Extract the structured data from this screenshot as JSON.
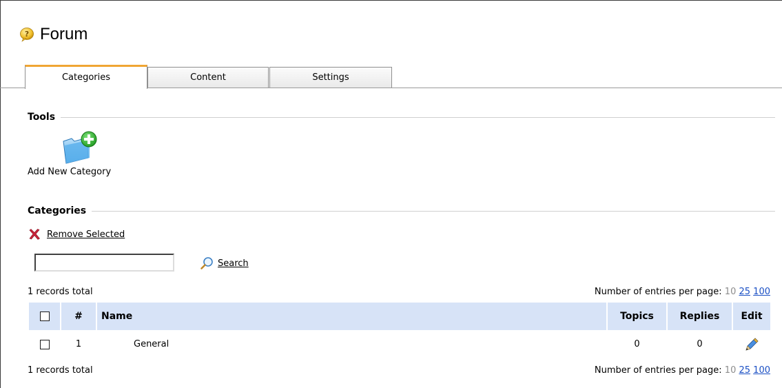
{
  "page": {
    "title": "Forum"
  },
  "tabs": [
    {
      "label": "Categories",
      "active": true
    },
    {
      "label": "Content",
      "active": false
    },
    {
      "label": "Settings",
      "active": false
    }
  ],
  "tools": {
    "heading": "Tools",
    "add_category_label": "Add New Category"
  },
  "categories": {
    "heading": "Categories",
    "remove_selected_label": "Remove Selected",
    "search": {
      "value": "",
      "button_label": "Search"
    },
    "records_total": "1 records total",
    "pager": {
      "label": "Number of entries per page:",
      "current": "10",
      "options": [
        "25",
        "100"
      ]
    },
    "table": {
      "columns": {
        "number": "#",
        "name": "Name",
        "topics": "Topics",
        "replies": "Replies",
        "edit": "Edit"
      },
      "rows": [
        {
          "number": "1",
          "name": "General",
          "topics": "0",
          "replies": "0"
        }
      ]
    }
  },
  "colors": {
    "tab_accent": "#f0a533",
    "table_header": "#d7e3f7",
    "link_blue": "#1a4fc4"
  },
  "icons": {
    "title": "forum-question-bubble-icon",
    "add_category": "folder-add-icon",
    "remove": "red-x-icon",
    "search": "magnifier-icon",
    "edit": "pencil-icon"
  }
}
